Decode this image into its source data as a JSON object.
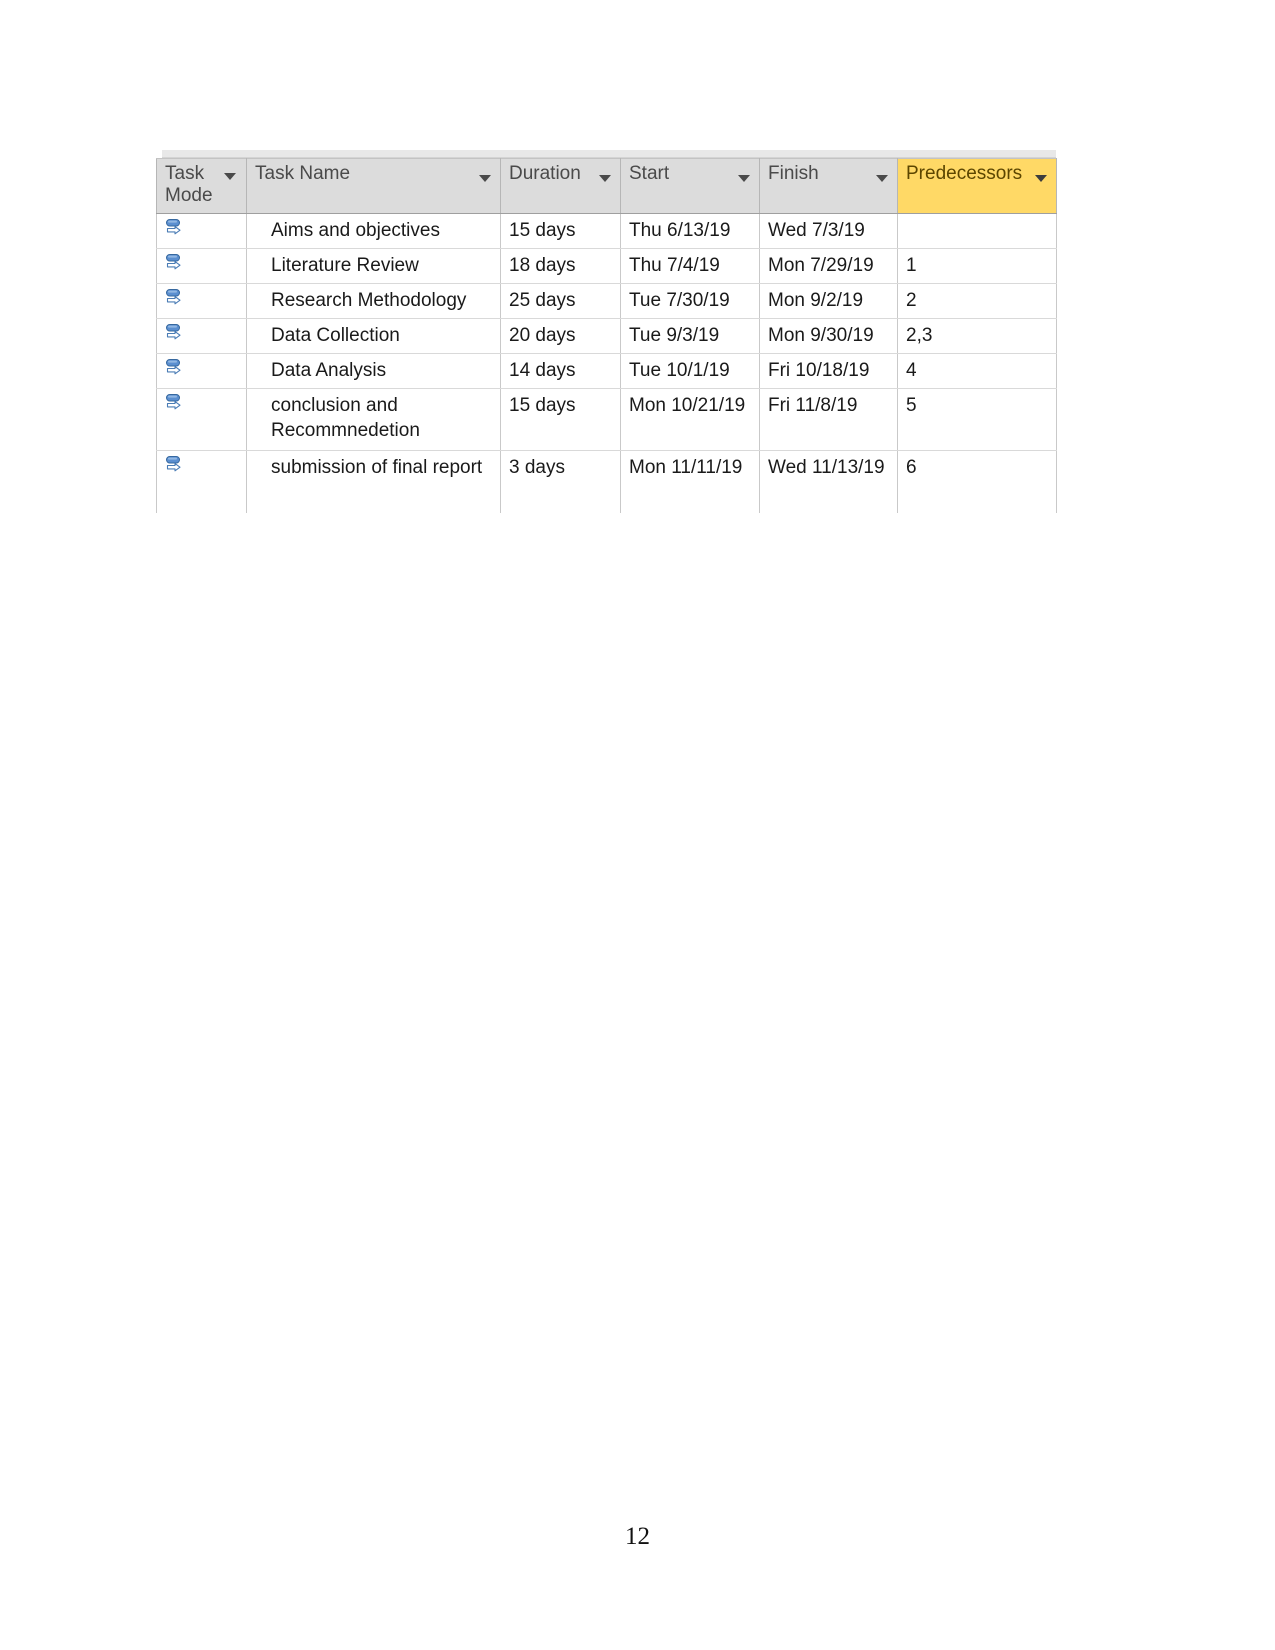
{
  "document": {
    "page_number": "12"
  },
  "table": {
    "name": "project-task-grid",
    "columns": [
      {
        "key": "task_mode",
        "label": "Task Mode",
        "icon": "filter-dropdown-icon",
        "highlight": false
      },
      {
        "key": "task_name",
        "label": "Task Name",
        "icon": "filter-dropdown-icon",
        "highlight": false
      },
      {
        "key": "duration",
        "label": "Duration",
        "icon": "filter-dropdown-icon",
        "highlight": false
      },
      {
        "key": "start",
        "label": "Start",
        "icon": "filter-dropdown-icon",
        "highlight": false
      },
      {
        "key": "finish",
        "label": "Finish",
        "icon": "filter-dropdown-icon",
        "highlight": false
      },
      {
        "key": "predecessors",
        "label": "Predecessors",
        "icon": "filter-dropdown-icon",
        "highlight": true
      }
    ],
    "header_highlight_color": "#ffd966",
    "header_background_color": "#dcdcdc",
    "rows": [
      {
        "task_mode_icon": "manually-scheduled-icon",
        "task_name": "Aims and objectives",
        "duration": "15 days",
        "start": "Thu 6/13/19",
        "finish": "Wed 7/3/19",
        "predecessors": ""
      },
      {
        "task_mode_icon": "manually-scheduled-icon",
        "task_name": "Literature Review",
        "duration": "18 days",
        "start": "Thu 7/4/19",
        "finish": "Mon 7/29/19",
        "predecessors": "1"
      },
      {
        "task_mode_icon": "manually-scheduled-icon",
        "task_name": "Research Methodology",
        "duration": "25 days",
        "start": "Tue 7/30/19",
        "finish": "Mon 9/2/19",
        "predecessors": "2"
      },
      {
        "task_mode_icon": "manually-scheduled-icon",
        "task_name": "Data Collection",
        "duration": "20 days",
        "start": "Tue 9/3/19",
        "finish": "Mon 9/30/19",
        "predecessors": "2,3"
      },
      {
        "task_mode_icon": "manually-scheduled-icon",
        "task_name": "Data Analysis",
        "duration": "14 days",
        "start": "Tue 10/1/19",
        "finish": "Fri 10/18/19",
        "predecessors": "4"
      },
      {
        "task_mode_icon": "manually-scheduled-icon",
        "task_name": "conclusion and Recommnedetion",
        "duration": "15 days",
        "start": "Mon 10/21/19",
        "finish": "Fri 11/8/19",
        "predecessors": "5"
      },
      {
        "task_mode_icon": "manually-scheduled-icon",
        "task_name": "submission of final report",
        "duration": "3 days",
        "start": "Mon 11/11/19",
        "finish": "Wed 11/13/19",
        "predecessors": "6"
      }
    ]
  }
}
